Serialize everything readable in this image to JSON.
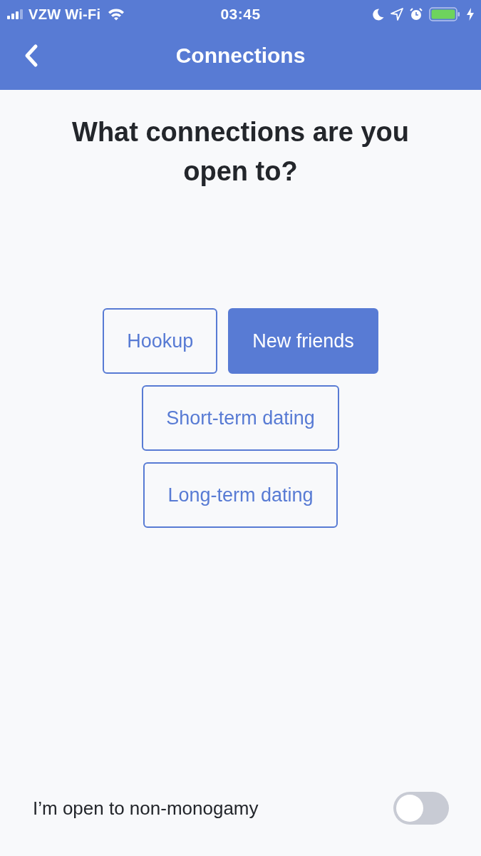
{
  "status_bar": {
    "carrier": "VZW Wi-Fi",
    "time": "03:45"
  },
  "nav_bar": {
    "title": "Connections"
  },
  "heading": "What connections are you open to?",
  "options": [
    {
      "label": "Hookup",
      "selected": false
    },
    {
      "label": "New friends",
      "selected": true
    },
    {
      "label": "Short-term dating",
      "selected": false
    },
    {
      "label": "Long-term dating",
      "selected": false
    }
  ],
  "toggle": {
    "label": "I’m open to non-monogamy",
    "on": false
  }
}
